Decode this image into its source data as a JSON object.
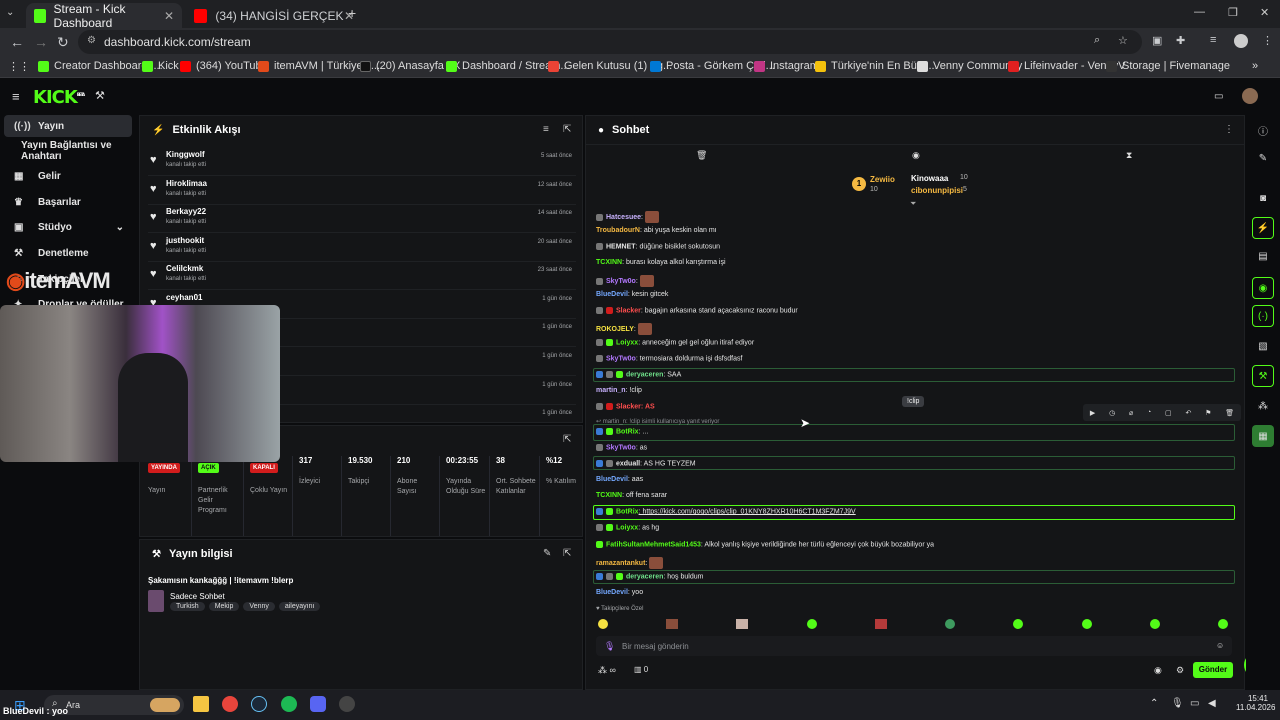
{
  "browser": {
    "tabs": [
      {
        "title": "Stream - Kick Dashboard",
        "active": true
      },
      {
        "title": "(34) HANGİSİ GERÇEK ESKİ SEV",
        "active": false
      }
    ],
    "url": "dashboard.kick.com/stream",
    "bookmarks": [
      "Creator Dashboard |...",
      "Kick",
      "(364) YouTube",
      "itemAVM | Türkiye'n...",
      "(20) Anasayfa / X",
      "Dashboard / Stream...",
      "Gelen Kutusu (1) - g...",
      "Posta - Görkem Çeti...",
      "Instagram",
      "Türkiye'nin En Büyü...",
      "Venny Community",
      "Lifeinvader - VennyV",
      "Storage | Fivemanage"
    ]
  },
  "kick": {
    "logo": "KICK",
    "logo_sup": "BETA"
  },
  "sidebar": {
    "items": [
      {
        "label": "Yayın",
        "icon": "broadcast-icon"
      },
      {
        "label": "Yayın Bağlantısı ve Anahtarı",
        "icon": ""
      },
      {
        "label": "Gelir",
        "icon": "dollar-icon"
      },
      {
        "label": "Başarılar",
        "icon": "trophy-icon"
      },
      {
        "label": "Stüdyo",
        "icon": "studio-icon"
      },
      {
        "label": "Denetleme",
        "icon": "hammer-icon"
      },
      {
        "label": "Takipçiler",
        "icon": "users-icon"
      },
      {
        "label": "Droplar ve ödüller",
        "icon": "gift-icon"
      }
    ],
    "overlay_logo": "itemAVM"
  },
  "activity": {
    "title": "Etkinlik Akışı",
    "events": [
      {
        "name": "Kinggwolf",
        "sub": "kanalı takip etti",
        "time": "5 saat önce"
      },
      {
        "name": "Hiroklimaa",
        "sub": "kanalı takip etti",
        "time": "12 saat önce"
      },
      {
        "name": "Berkayy22",
        "sub": "kanalı takip etti",
        "time": "14 saat önce"
      },
      {
        "name": "justhookit",
        "sub": "kanalı takip etti",
        "time": "20 saat önce"
      },
      {
        "name": "Celilckmk",
        "sub": "kanalı takip etti",
        "time": "23 saat önce"
      },
      {
        "name": "ceyhan01",
        "sub": "",
        "time": "1 gün önce"
      },
      {
        "name": "",
        "sub": "",
        "time": "1 gün önce"
      },
      {
        "name": "",
        "sub": "",
        "time": "1 gün önce"
      },
      {
        "name": "",
        "sub": "",
        "time": "1 gün önce"
      },
      {
        "name": "",
        "sub": "",
        "time": "1 gün önce"
      }
    ]
  },
  "stats": [
    {
      "value": "YAYINDA",
      "label": "Yayın",
      "pill_color": "#d21c1c"
    },
    {
      "value": "AÇIK",
      "label": "Partnerlik Gelir Programı",
      "pill_color": "#53fc18"
    },
    {
      "value": "KAPALI",
      "label": "Çoklu Yayın",
      "pill_color": "#d21c1c"
    },
    {
      "value": "317",
      "label": "İzleyici"
    },
    {
      "value": "19.530",
      "label": "Takipçi"
    },
    {
      "value": "210",
      "label": "Abone Sayısı"
    },
    {
      "value": "00:23:55",
      "label": "Yayında Olduğu Süre"
    },
    {
      "value": "38",
      "label": "Ort. Sohbete Katılanlar"
    },
    {
      "value": "%12",
      "label": "% Katılım"
    }
  ],
  "stream_info": {
    "title": "Yayın bilgisi",
    "stream_title": "Şakamısın kankağğğ | !itemavm !blerp",
    "category": "Sadece Sohbet",
    "tags": [
      "Turkish",
      "Mekip",
      "Venny",
      "aileyayını"
    ]
  },
  "chat": {
    "title": "Sohbet",
    "top_users": [
      {
        "name": "Zewiio",
        "count": "10"
      },
      {
        "name": "Kinowaaa",
        "count": "10"
      },
      {
        "name": "cibonunpipisi",
        "count": "5"
      }
    ],
    "messages": [
      {
        "user": "Hatcesuee",
        "color": "#c9b2ff",
        "text": ":",
        "emote": true
      },
      {
        "user": "TroubadourN",
        "color": "#f5b942",
        "text": ": abi yuşa keskin olan mı"
      },
      {
        "user": "HEMNET",
        "color": "#e6e6e6",
        "text": ": düğüne bisiklet sokutosun"
      },
      {
        "user": "TCXINN",
        "color": "#53fc18",
        "text": ": burası kolaya alkol karıştırma işi"
      },
      {
        "user": "SkyTw0o",
        "color": "#b379ff",
        "text": ":",
        "emote": true
      },
      {
        "user": "BlueDevil",
        "color": "#74a8ff",
        "text": ": kesin gitcek"
      },
      {
        "user": "Slacker",
        "color": "#ff4e4e",
        "text": ": bagajın arkasına stand açacaksınız raconu budur"
      },
      {
        "user": "ROKOJELY",
        "color": "#f5e142",
        "text": ":",
        "emote": true
      },
      {
        "user": "Loiyxx",
        "color": "#53fc18",
        "text": ": anneceğim gel gel oğlun itiraf ediyor"
      },
      {
        "user": "SkyTw0o",
        "color": "#b379ff",
        "text": ": termosiara doldurma işi dsfsdfasf"
      },
      {
        "user": "deryaceren",
        "color": "#6fe08a",
        "text": ": SAA"
      },
      {
        "user": "martin_n",
        "color": "#c9b2ff",
        "text": ": !clip"
      },
      {
        "user": "Slacker",
        "color": "#ff4e4e",
        "text": ": AS"
      },
      {
        "user": "BotRix",
        "color": "#53fc18",
        "text": ": ..."
      },
      {
        "user": "SkyTw0o",
        "color": "#b379ff",
        "text": ": as"
      },
      {
        "user": "exduall",
        "color": "#e6e6e6",
        "text": ": AS HG TEYZEM"
      },
      {
        "user": "BlueDevil",
        "color": "#74a8ff",
        "text": ": aas"
      },
      {
        "user": "TCXINN",
        "color": "#53fc18",
        "text": ": off fena sarar"
      },
      {
        "user": "BotRix",
        "color": "#53fc18",
        "text": ": https://kick.com/gogo/clips/clip_01KNY8ZHXR10H6CT1M3FZM7J9V"
      },
      {
        "user": "Loiyxx",
        "color": "#53fc18",
        "text": ": as hg"
      },
      {
        "user": "FatihSultanMehmetSaid1453",
        "color": "#53fc18",
        "text": ": Alkol yanlış kişiye verildiğinde her türlü eğlenceyi çok büyük bozabiliyor ya"
      },
      {
        "user": "ramazantankut",
        "color": "#f5b942",
        "text": ":",
        "emote": true
      },
      {
        "user": "deryaceren",
        "color": "#6fe08a",
        "text": ": hoş buldum"
      },
      {
        "user": "BlueDevil",
        "color": "#74a8ff",
        "text": ": yoo"
      }
    ],
    "reply_note": "martin_n: !clip isimli kullanıcıya yanıt veriyor",
    "tooltip": "!clip",
    "followers_label": "Takipçilere Özel",
    "input_placeholder": "Bir mesaj gönderin",
    "send_label": "Gönder",
    "bottom_count": "0"
  },
  "taskbar": {
    "search": "Ara",
    "time": "15:41",
    "date": "11.04.2026",
    "overlay_text": "BlueDevil : yoo"
  }
}
